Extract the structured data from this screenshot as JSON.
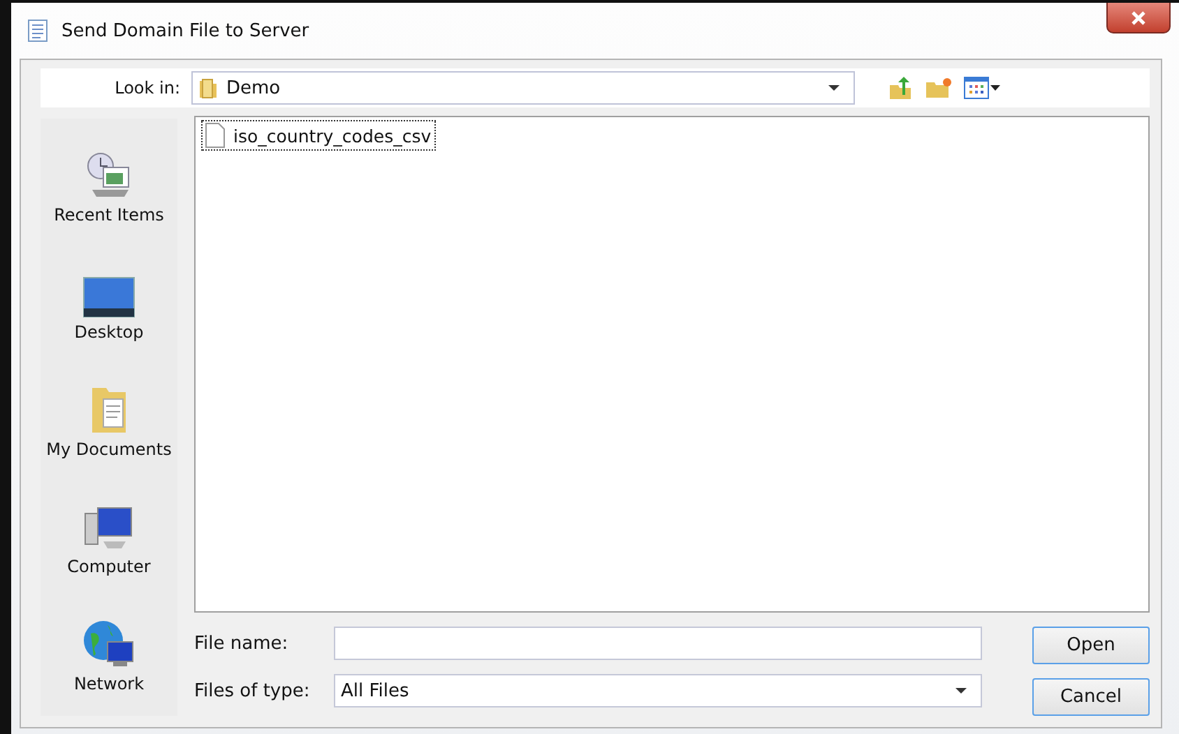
{
  "window": {
    "title": "Send Domain File to Server"
  },
  "look_in": {
    "label": "Look in:",
    "value": "Demo"
  },
  "places": [
    {
      "kind": "recent",
      "label": "Recent Items"
    },
    {
      "kind": "desktop",
      "label": "Desktop"
    },
    {
      "kind": "documents",
      "label": "My Documents"
    },
    {
      "kind": "computer",
      "label": "Computer"
    },
    {
      "kind": "network",
      "label": "Network"
    }
  ],
  "files": [
    {
      "name": "iso_country_codes_csv",
      "selected": true
    }
  ],
  "file_name": {
    "label": "File name:"
  },
  "file_type": {
    "label": "Files of type:",
    "value": "All Files"
  },
  "buttons": [
    "Open",
    "Cancel"
  ]
}
